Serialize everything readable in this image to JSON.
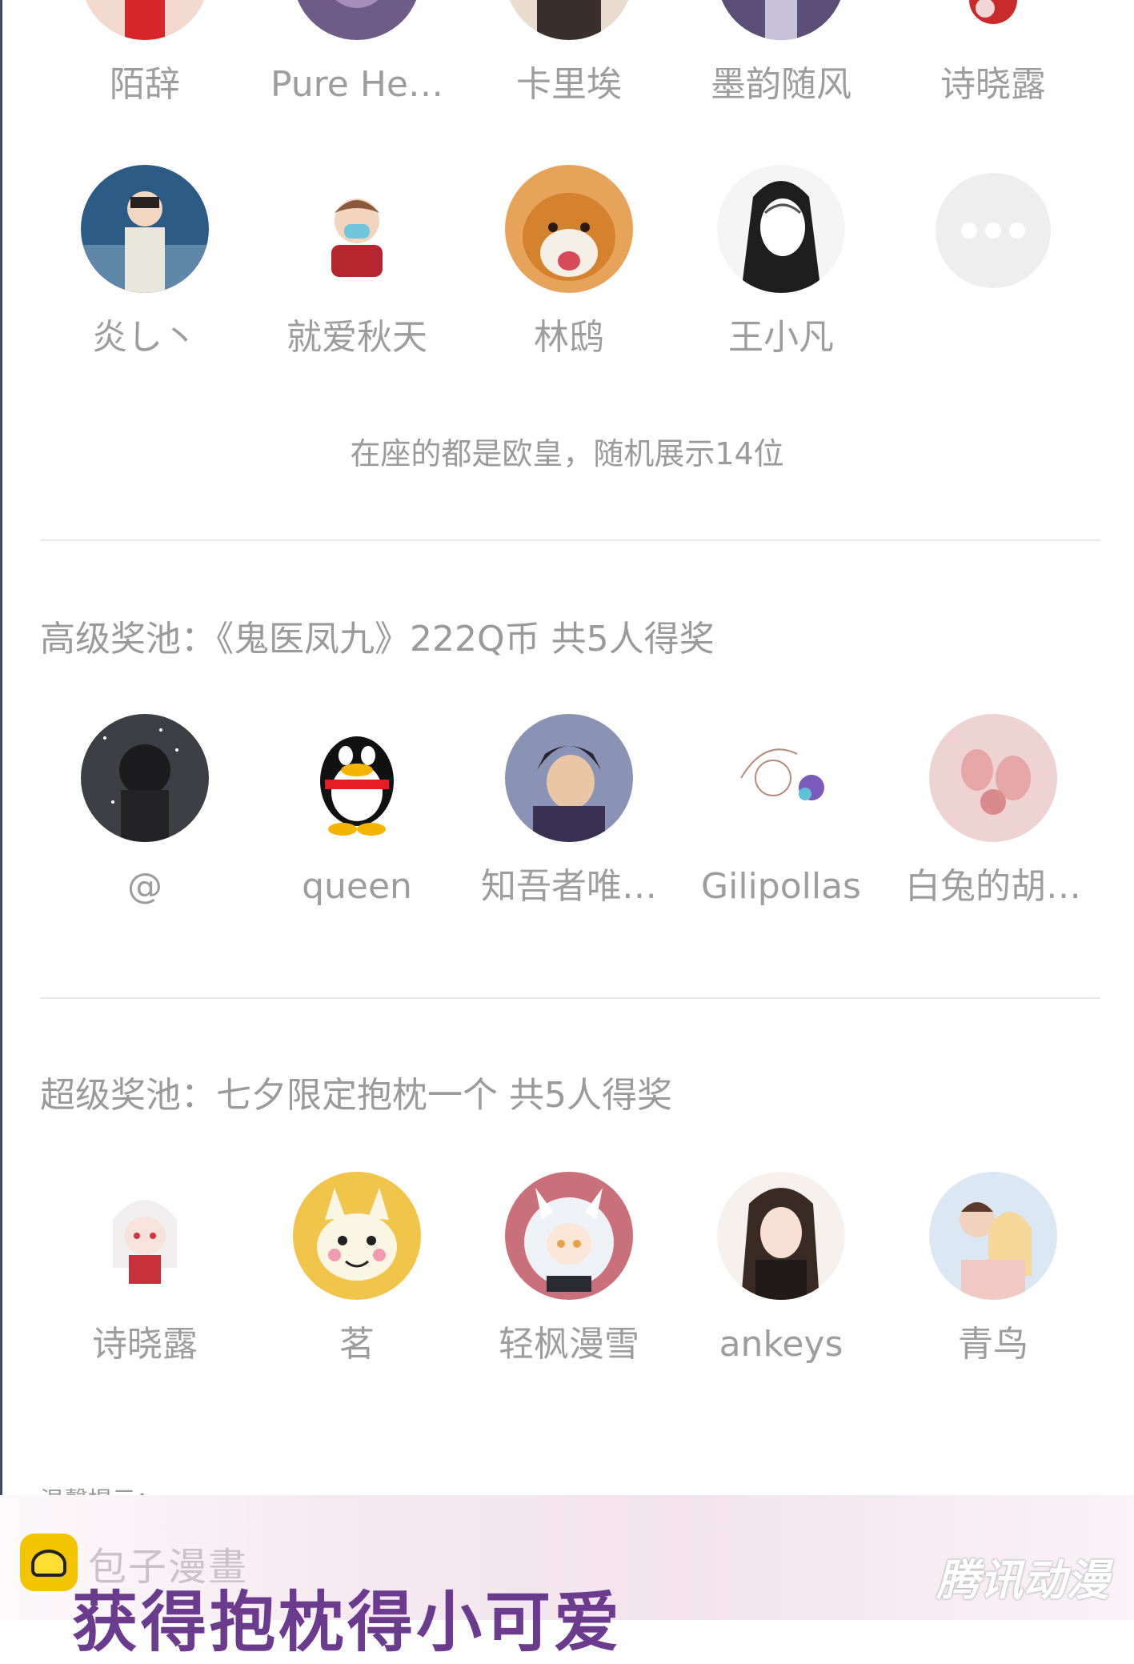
{
  "lucky_users": {
    "row1": [
      "陌辞",
      "Pure He…",
      "卡里埃",
      "墨韵随风",
      "诗晓露"
    ],
    "row2": [
      "炎し丶",
      "就爱秋天",
      "林鸱",
      "王小凡"
    ],
    "more_button_icon": "more-dots-icon",
    "note": "在座的都是欧皇，随机展示14位"
  },
  "senior_pool": {
    "title": "高级奖池：《鬼医凤九》222Q币 共5人得奖",
    "winners": [
      "@",
      "queen",
      "知吾者唯…",
      "Gilipollas",
      "白兔的胡…"
    ]
  },
  "super_pool": {
    "title": "超级奖池：七夕限定抱枕一个 共5人得奖",
    "winners": [
      "诗晓露",
      "茗",
      "轻枫漫雪",
      "ankeys",
      "青鸟"
    ]
  },
  "next_section_cut": "温馨提示：",
  "banner": {
    "watermark": "包子漫畫",
    "headline": "获得抱枕得小可爱",
    "brand": "腾讯动漫"
  },
  "colors": {
    "text_gray": "#9a9a9a",
    "divider": "#e8e8ec",
    "banner_purple": "#6b3b8e"
  }
}
